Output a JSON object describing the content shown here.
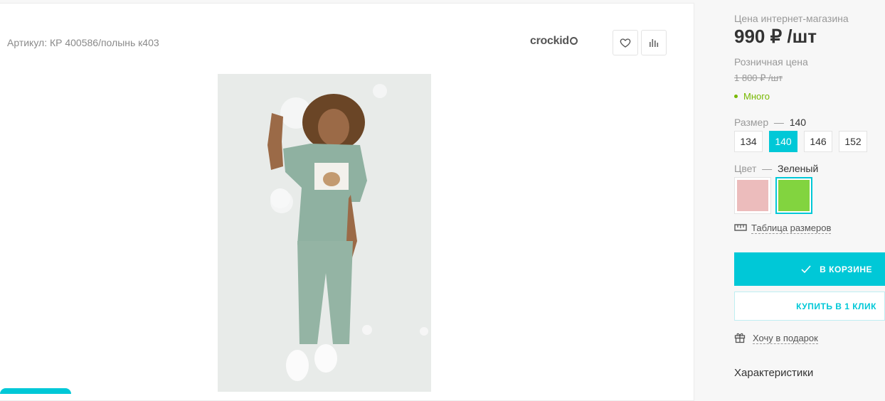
{
  "product": {
    "sku": "Артикул: КР 400586/полынь к403",
    "brand": "crockid",
    "photo_alt": "Девочка в костюме полынного цвета"
  },
  "icons": {
    "favorite": "heart-icon",
    "compare": "bar-chart-icon"
  },
  "side": {
    "online_price_label": "Цена интернет-магазина",
    "price": "990 ₽ /шт",
    "retail_label": "Розничная цена",
    "retail_price": "1 800 ₽ /шт",
    "stock": "Много",
    "size_label": "Размер",
    "size_dash": "—",
    "size_value": "140",
    "sizes": [
      "134",
      "140",
      "146",
      "152"
    ],
    "selected_size": "140",
    "color_label": "Цвет",
    "color_dash": "—",
    "color_value": "Зеленый",
    "colors": [
      "#ecbcbc",
      "#82d43f"
    ],
    "size_table": "Таблица размеров",
    "in_cart": "В КОРЗИНЕ",
    "buy_one_click": "КУПИТЬ В 1 КЛИК",
    "gift": "Хочу в подарок",
    "characteristics": "Характеристики"
  },
  "colors": {
    "accent": "#00c8d7",
    "stock_green": "#77b800"
  }
}
